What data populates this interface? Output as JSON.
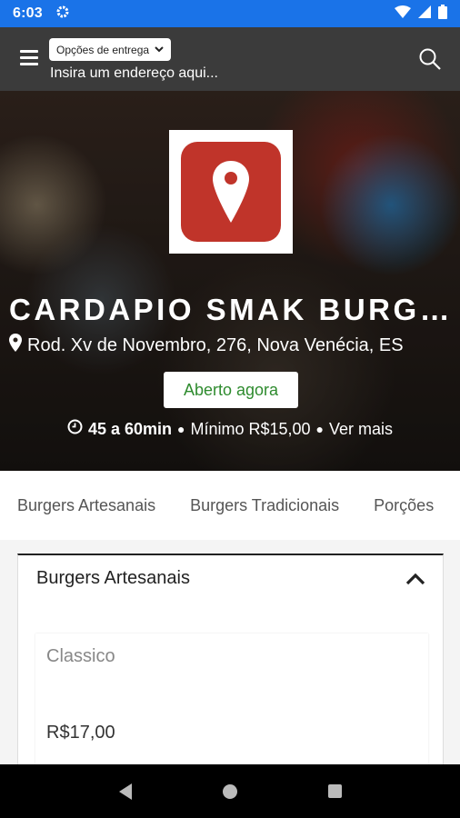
{
  "status_bar": {
    "time": "6:03"
  },
  "header": {
    "delivery_options_label": "Opções de entrega",
    "address_placeholder": "Insira um endereço aqui..."
  },
  "store": {
    "name": "CARDAPIO SMAK BURGUER",
    "address": "Rod. Xv de Novembro, 276, Nova Venécia, ES",
    "status": "Aberto agora",
    "delivery_time": "45 a 60min",
    "minimum": "Mínimo R$15,00",
    "more_link": "Ver mais"
  },
  "tabs": [
    "Burgers Artesanais",
    "Burgers Tradicionais",
    "Porções"
  ],
  "category": {
    "title": "Burgers Artesanais",
    "products": [
      {
        "name": "Classico",
        "price": "R$17,00"
      }
    ]
  },
  "colors": {
    "status_bar": "#1a73e8",
    "header": "#3b3b3b",
    "logo": "#c0342a",
    "open_badge_text": "#2e8b2e"
  }
}
